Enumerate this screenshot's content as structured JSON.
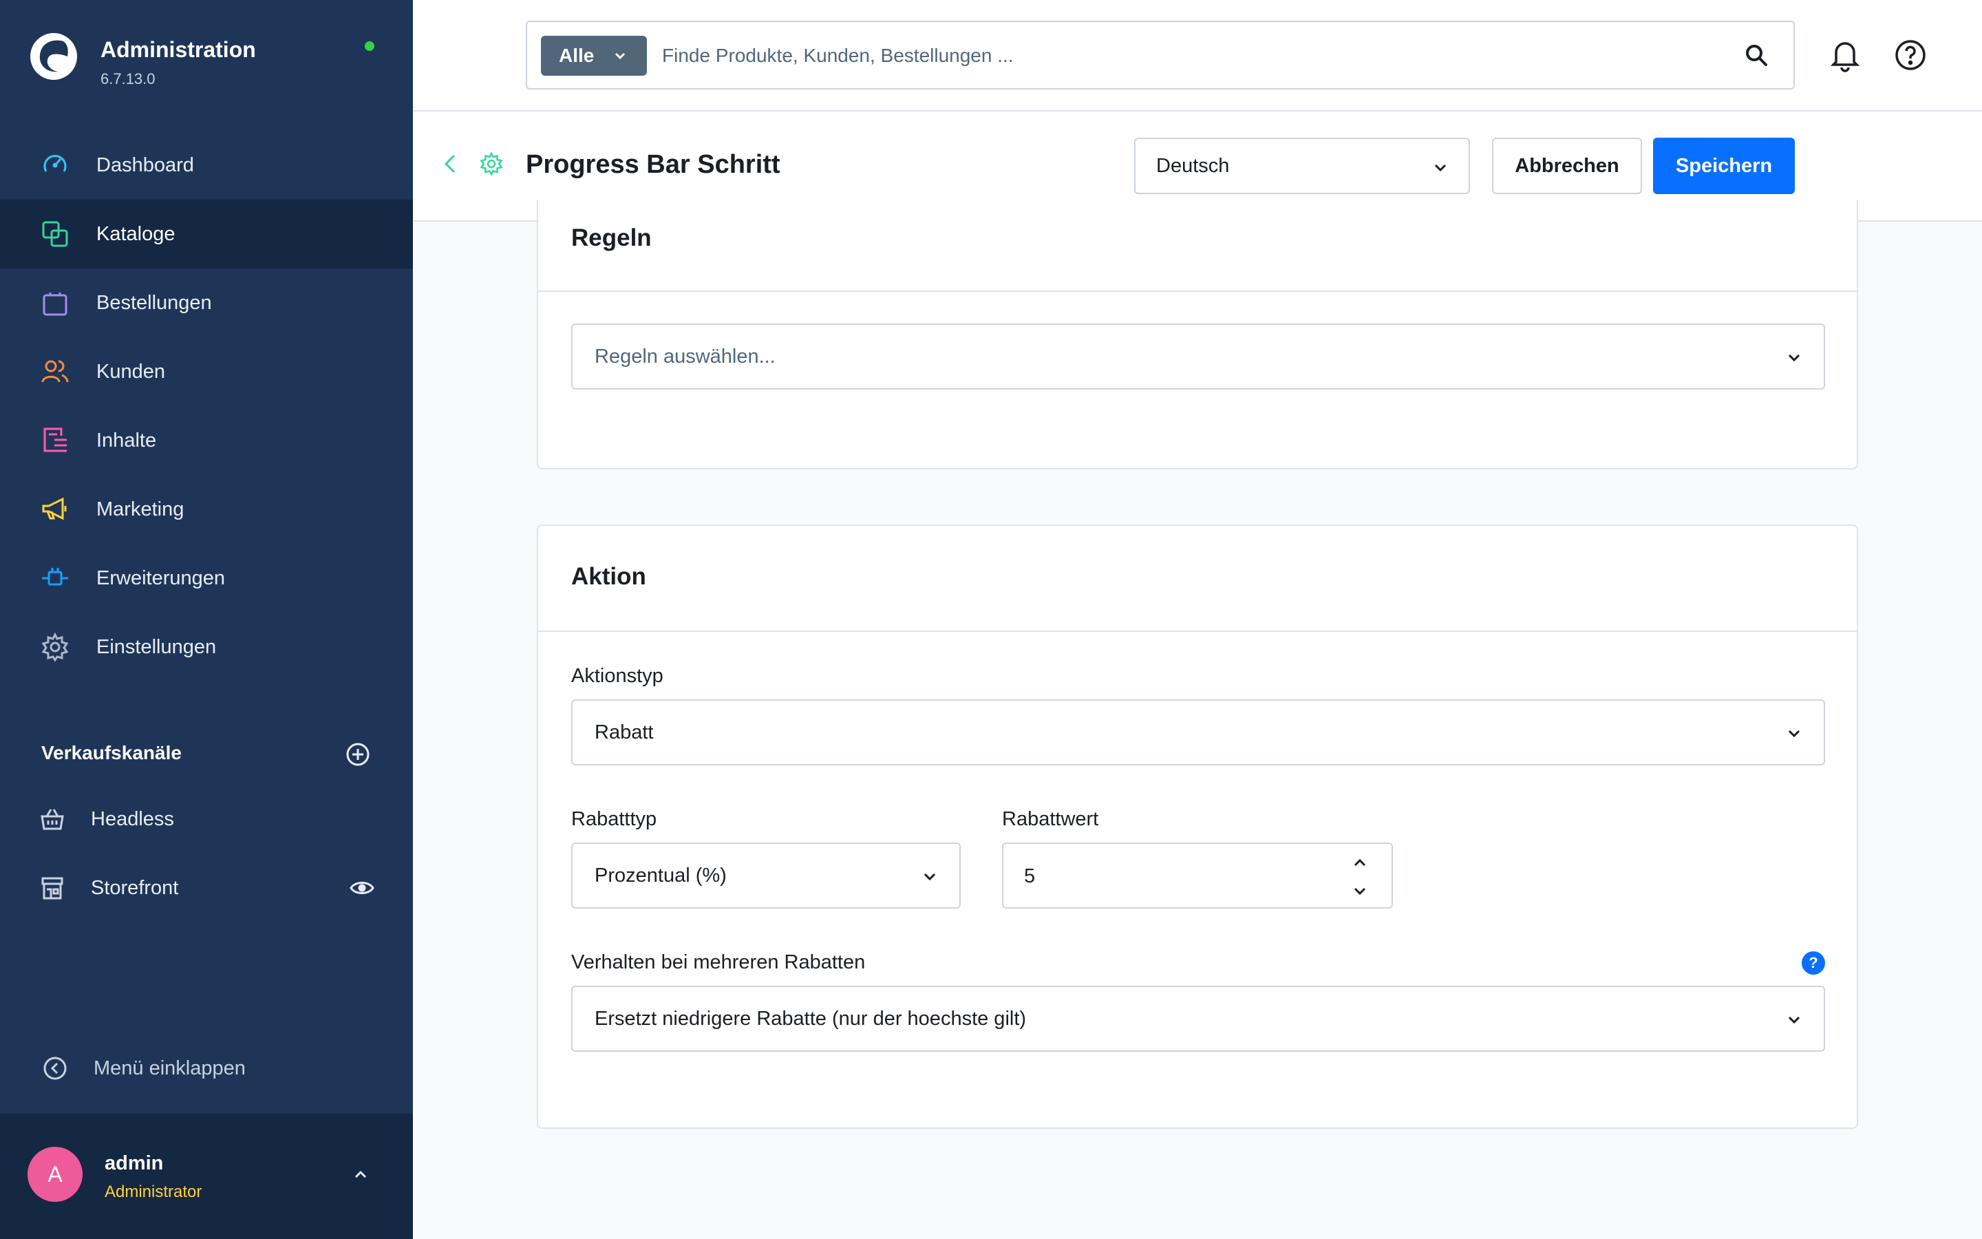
{
  "brand": {
    "name": "Administration",
    "version": "6.7.13.0"
  },
  "nav": [
    {
      "label": "Dashboard",
      "icon": "dashboard-icon",
      "color": "#36c4f5"
    },
    {
      "label": "Kataloge",
      "icon": "catalogue-icon",
      "color": "#35d59a",
      "active": true
    },
    {
      "label": "Bestellungen",
      "icon": "orders-bag-icon",
      "color": "#a58cf3"
    },
    {
      "label": "Kunden",
      "icon": "customers-icon",
      "color": "#fb8c3c"
    },
    {
      "label": "Inhalte",
      "icon": "content-icon",
      "color": "#ff5bb0"
    },
    {
      "label": "Marketing",
      "icon": "megaphone-icon",
      "color": "#ffd23a"
    },
    {
      "label": "Erweiterungen",
      "icon": "plug-icon",
      "color": "#189eff"
    },
    {
      "label": "Einstellungen",
      "icon": "gear-icon",
      "color": "#aab8c8"
    }
  ],
  "sales_channels": {
    "title": "Verkaufskanäle",
    "items": [
      {
        "label": "Headless",
        "icon": "basket-icon"
      },
      {
        "label": "Storefront",
        "icon": "storefront-icon"
      }
    ]
  },
  "collapse_label": "Menü einklappen",
  "user": {
    "initial": "A",
    "name": "admin",
    "role": "Administrator"
  },
  "search": {
    "filter_label": "Alle",
    "placeholder": "Finde Produkte, Kunden, Bestellungen ..."
  },
  "header": {
    "title": "Progress Bar Schritt",
    "language": "Deutsch",
    "cancel_label": "Abbrechen",
    "save_label": "Speichern"
  },
  "rules_card": {
    "title": "Regeln",
    "select_placeholder": "Regeln auswählen..."
  },
  "action_card": {
    "title": "Aktion",
    "action_type_label": "Aktionstyp",
    "action_type_value": "Rabatt",
    "discount_type_label": "Rabatttyp",
    "discount_type_value": "Prozentual (%)",
    "discount_value_label": "Rabattwert",
    "discount_value": "5",
    "behavior_label": "Verhalten bei mehreren Rabatten",
    "behavior_value": "Ersetzt niedrigere Rabatte (nur der hoechste gilt)",
    "help_glyph": "?"
  },
  "colors": {
    "sidebar": "#1f3558",
    "sidebar_active": "#142743",
    "primary": "#0870ff",
    "online": "#37d046",
    "avatar": "#ee5a9a",
    "role": "#ffd23a"
  }
}
